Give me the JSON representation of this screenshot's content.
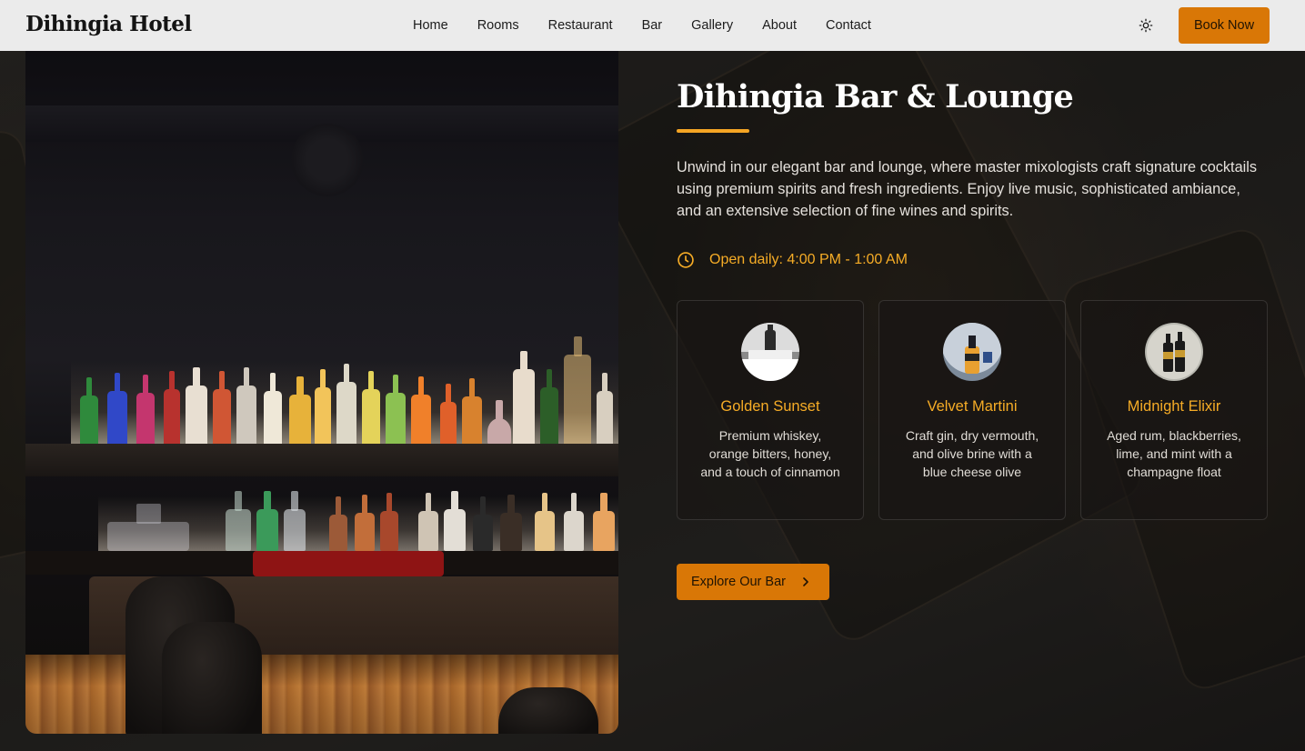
{
  "brand": {
    "name": "Dihingia Hotel"
  },
  "nav": {
    "items": [
      {
        "label": "Home"
      },
      {
        "label": "Rooms"
      },
      {
        "label": "Restaurant"
      },
      {
        "label": "Bar"
      },
      {
        "label": "Gallery"
      },
      {
        "label": "About"
      },
      {
        "label": "Contact"
      }
    ],
    "theme_toggle_icon": "sun-icon",
    "book_label": "Book Now"
  },
  "hero": {
    "title": "Dihingia Bar & Lounge",
    "description": "Unwind in our elegant bar and lounge, where master mixologists craft signature cocktails using premium spirits and fresh ingredients. Enjoy live music, sophisticated ambiance, and an extensive selection of fine wines and spirits.",
    "hours_icon": "clock-icon",
    "hours": "Open daily: 4:00 PM - 1:00 AM",
    "explore_label": "Explore Our Bar",
    "explore_icon": "chevron-right-icon"
  },
  "cocktails": [
    {
      "name": "Golden Sunset",
      "description": "Premium whiskey, orange bitters, honey, and a touch of cinnamon"
    },
    {
      "name": "Velvet Martini",
      "description": "Craft gin, dry vermouth, and olive brine with a blue cheese olive"
    },
    {
      "name": "Midnight Elixir",
      "description": "Aged rum, blackberries, lime, and mint with a champagne float"
    }
  ],
  "colors": {
    "accent": "#d97706",
    "accent_text": "#f6ac26",
    "nav_bg": "#ebebeb"
  }
}
